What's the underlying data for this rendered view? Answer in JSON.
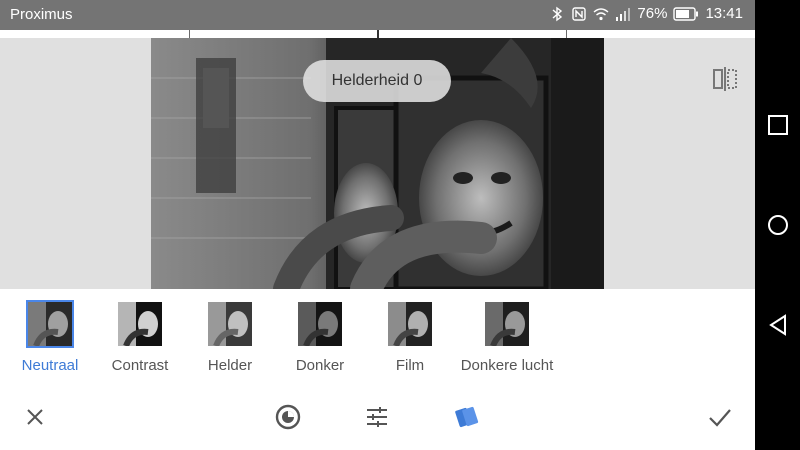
{
  "status_bar": {
    "carrier": "Proximus",
    "battery_percent": "76%",
    "time": "13:41",
    "icons": [
      "bluetooth-icon",
      "nfc-icon",
      "wifi-icon",
      "signal-icon",
      "battery-icon"
    ]
  },
  "preview": {
    "adjust_label": "Helderheid 0",
    "compare_icon": "compare-split-icon"
  },
  "presets": [
    {
      "label": "Neutraal",
      "selected": true
    },
    {
      "label": "Contrast",
      "selected": false
    },
    {
      "label": "Helder",
      "selected": false
    },
    {
      "label": "Donker",
      "selected": false
    },
    {
      "label": "Film",
      "selected": false
    },
    {
      "label": "Donkere lucht",
      "selected": false
    }
  ],
  "toolbar": {
    "cancel_icon": "close-icon",
    "filter_icon": "grain-dial-icon",
    "tune_icon": "sliders-icon",
    "style_icon": "style-cards-icon",
    "apply_icon": "checkmark-icon"
  },
  "colors": {
    "accent": "#3e7bd6",
    "status_bar": "#747474",
    "preview_bg": "#e0e0e0"
  }
}
